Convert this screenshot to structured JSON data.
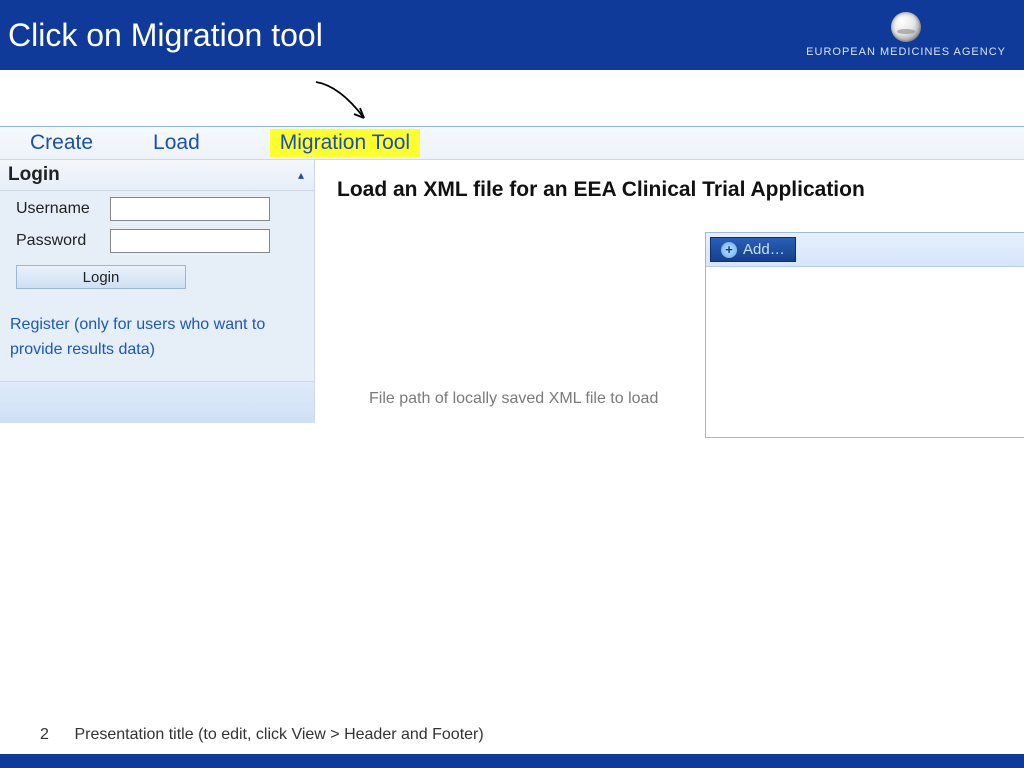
{
  "slide": {
    "title": "Click on Migration tool",
    "page_number": "2",
    "footer_text": "Presentation title (to edit, click View > Header and Footer)"
  },
  "brand": {
    "name": "EUROPEAN MEDICINES AGENCY"
  },
  "menubar": {
    "create": "Create",
    "load": "Load",
    "migration_tool": "Migration Tool"
  },
  "sidebar": {
    "login_title": "Login",
    "username_label": "Username",
    "username_value": "",
    "password_label": "Password",
    "password_value": "",
    "login_button": "Login",
    "register_link": "Register (only for users who want to provide results data)"
  },
  "main": {
    "heading": "Load an XML file for an EEA Clinical Trial Application",
    "file_path_label": "File path of locally saved XML file to load",
    "add_button": "Add…"
  }
}
